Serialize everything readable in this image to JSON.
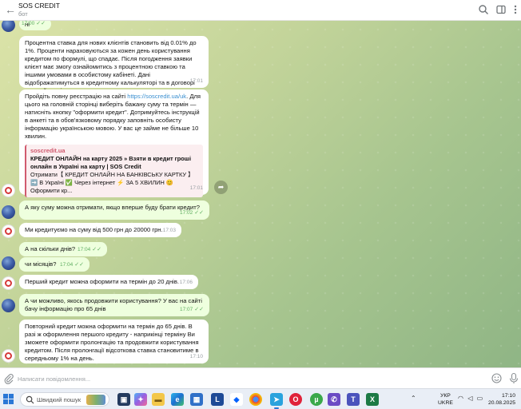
{
  "header": {
    "title": "SOS CREDIT",
    "subtitle": "бот"
  },
  "messages": [
    {
      "type": "out",
      "text": "ні",
      "time": "17:00"
    },
    {
      "type": "in",
      "text": "Процентна ставка для нових клієнтів становить від 0.01% до 1%. Проценти нараховуються за кожен день користування кредитом по формулі, що спадає. Після погодження заявки клієнт має змогу ознайомитись з процентною ставкою та іншими умовами в особистому кабінеті. Дані відображатимуться в кредитному калькуляторі та в договорі перед його підписанням.",
      "time": "17:01"
    },
    {
      "type": "in",
      "text_before": "Пройдіть повну реєстрацію на сайті ",
      "link": "https://soscredit.ua/uk",
      "text_after": ". Для цього на головній сторінці виберіть бажану суму та термін — натисніть кнопку \"оформити кредит\". Дотримуйтесь інструкцій в анкеті та в обов'язковому порядку заповніть особисту інформацію українською мовою. У вас це займе не більше 10 хвилин.",
      "preview_site": "soscredit.ua",
      "preview_title": "КРЕДИТ ОНЛАЙН на карту 2025 » Взяти в кредит гроші онлайн в Україні на карту | SOS Credit",
      "preview_desc": "Отримати【 КРЕДИТ ОНЛАЙН НА БАНКІВСЬКУ КАРТКУ 】➡️ В Україні ✅ Через інтернет ⚡ ЗА 5 ХВИЛИН 😊 Оформити кр...",
      "time": "17:01"
    },
    {
      "type": "out",
      "text": "А яку суму можна отримати, якщо вперше буду брати кредит?",
      "time": "17:02"
    },
    {
      "type": "in",
      "text": "Ми кредитуємо на суму від 500 грн до 20000 грн.",
      "time": "17:03"
    },
    {
      "type": "out",
      "text": "А на скільки днів?",
      "time": "17:04"
    },
    {
      "type": "out",
      "text": "чи місяців?",
      "time": "17:04"
    },
    {
      "type": "in",
      "text": "Перший кредит можна оформити на термін до 20 днів.",
      "time": "17:06"
    },
    {
      "type": "out",
      "text": "А чи можливо, якось продовжити користування? У вас на сайті бачу інформацію про 65 днів",
      "time": "17:07"
    },
    {
      "type": "in",
      "text": "Повторний кредит можна оформити на термін до 65 днів. В разі ж оформлення першого кредиту - наприкінці терміну Ви зможете оформити пролонгацію та продовжити користування кредитом. Після пролонгації відсоткова ставка становитиме в середньому 1% на день.",
      "time": "17:10"
    }
  ],
  "composer": {
    "placeholder": "Написати повідомлення..."
  },
  "taskbar": {
    "search_placeholder": "Швидкий пошук",
    "lang_line1": "УКР",
    "lang_line2": "UKRE",
    "time": "17:10",
    "date": "20.08.2025"
  },
  "colors": {
    "outgoing_bubble": "#eeffde",
    "incoming_bubble": "#ffffff",
    "accent_link": "#3a8fd0",
    "check_green": "#5fae61",
    "preview_accent": "#d05a6e"
  }
}
